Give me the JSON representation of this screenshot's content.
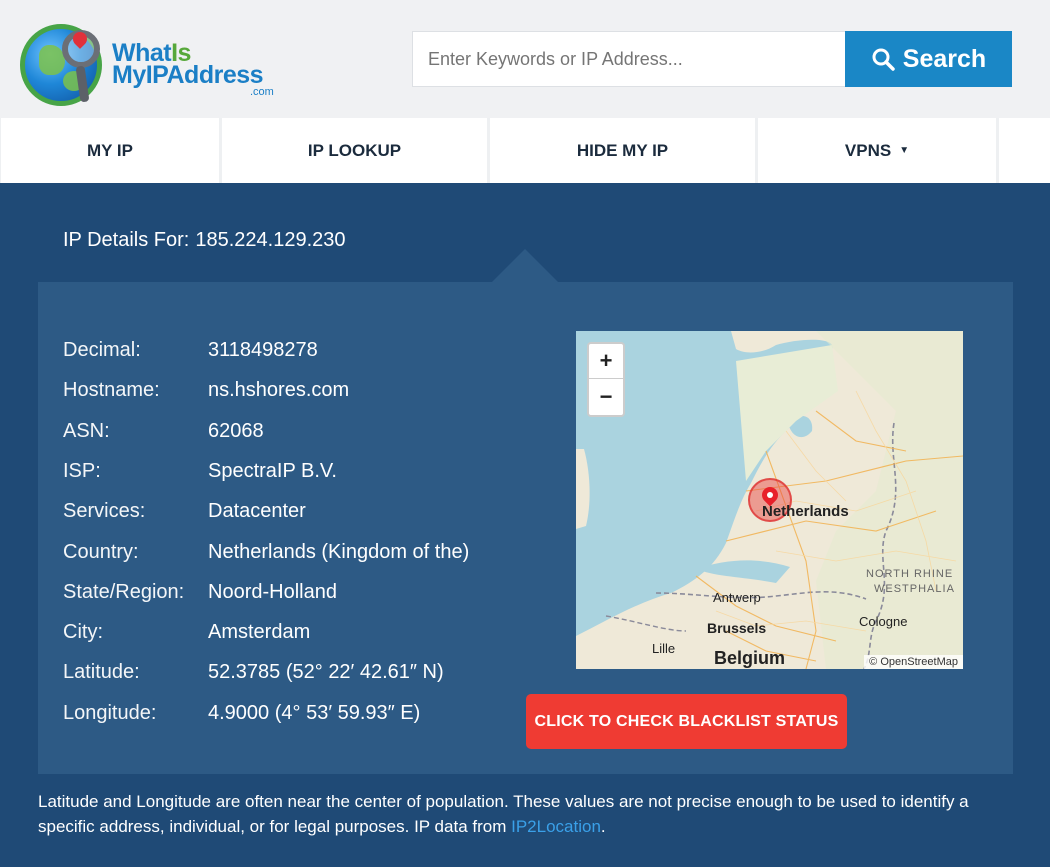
{
  "logo": {
    "line1_a": "What",
    "line1_b": "Is",
    "line2": "MyIPAddress",
    "suffix": ".com"
  },
  "search": {
    "placeholder": "Enter Keywords or IP Address...",
    "button_label": "Search"
  },
  "nav": {
    "items": [
      {
        "label": "MY IP"
      },
      {
        "label": "IP LOOKUP"
      },
      {
        "label": "HIDE MY IP"
      },
      {
        "label": "VPNS"
      }
    ]
  },
  "details": {
    "heading": "IP Details For:",
    "ip": "185.224.129.230",
    "rows": [
      {
        "label": "Decimal:",
        "value": "3118498278"
      },
      {
        "label": "Hostname:",
        "value": "ns.hshores.com"
      },
      {
        "label": "ASN:",
        "value": "62068"
      },
      {
        "label": "ISP:",
        "value": "SpectraIP B.V."
      },
      {
        "label": "Services:",
        "value": "Datacenter"
      },
      {
        "label": "Country:",
        "value": "Netherlands (Kingdom of the)"
      },
      {
        "label": "State/Region:",
        "value": "Noord-Holland"
      },
      {
        "label": "City:",
        "value": "Amsterdam"
      },
      {
        "label": "Latitude:",
        "value": "52.3785 (52° 22′ 42.61″ N)"
      },
      {
        "label": "Longitude:",
        "value": "4.9000 (4° 53′ 59.93″ E)"
      }
    ]
  },
  "map": {
    "zoom_in": "+",
    "zoom_out": "−",
    "labels": {
      "netherlands": "Netherlands",
      "antwerp": "Antwerp",
      "brussels": "Brussels",
      "belgium": "Belgium",
      "lille": "Lille",
      "cologne": "Cologne",
      "nrw1": "NORTH RHINE",
      "nrw2": "WESTPHALIA"
    },
    "attribution": "© OpenStreetMap"
  },
  "blacklist_button": "CLICK TO CHECK BLACKLIST STATUS",
  "footnote": {
    "text": "Latitude and Longitude are often near the center of population. These values are not precise enough to be used to identify a specific address, individual, or for legal purposes. IP data from ",
    "link": "IP2Location",
    "end": "."
  },
  "colors": {
    "brand_blue": "#1a87c6",
    "page_bg": "#1f4a76",
    "panel_bg": "#2d5a85",
    "danger": "#ef3b33",
    "link": "#3aa0e8"
  }
}
